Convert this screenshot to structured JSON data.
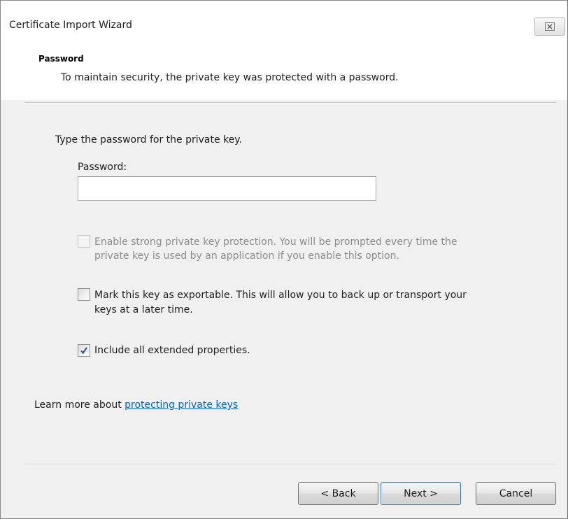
{
  "window": {
    "title": "Certificate Import Wizard"
  },
  "header": {
    "title": "Password",
    "description": "To maintain security, the private key was protected with a password."
  },
  "content": {
    "instruction": "Type the password for the private key.",
    "password_label": "Password:",
    "password_value": "",
    "options": [
      {
        "line1": "Enable strong private key protection. You will be prompted every time the",
        "line2": "private key is used by an application if you enable this option.",
        "checked": false,
        "enabled": false
      },
      {
        "line1": "Mark this key as exportable. This will allow you to back up or transport your",
        "line2": "keys at a later time.",
        "checked": false,
        "enabled": true
      },
      {
        "line1": "Include all extended properties.",
        "checked": true,
        "enabled": true
      }
    ],
    "learn_more_prefix": "Learn more about ",
    "learn_more_link": "protecting private keys"
  },
  "footer": {
    "back_label": "< Back",
    "next_label": "Next >",
    "cancel_label": "Cancel"
  },
  "icons": {
    "close": "close-icon",
    "check": "checkmark-icon"
  },
  "colors": {
    "link": "#0066cc",
    "disabled_text": "#8c8c8c",
    "check": "#2b4a9a"
  }
}
